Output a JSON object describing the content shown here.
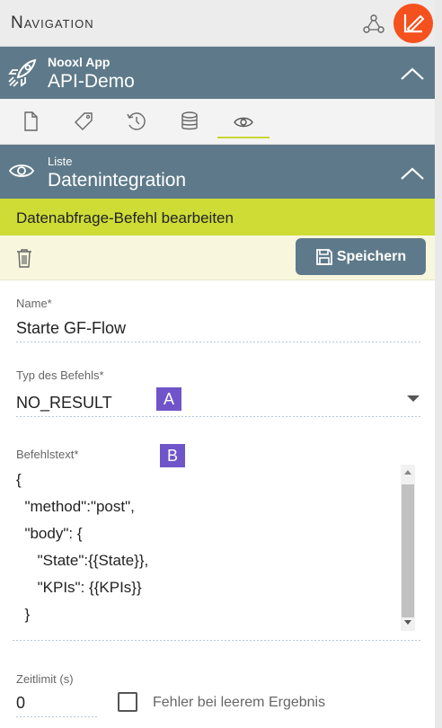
{
  "header": {
    "title": "Navigation"
  },
  "app": {
    "subtitle": "Nooxl App",
    "title": "API-Demo"
  },
  "section": {
    "subtitle": "Liste",
    "title": "Datenintegration"
  },
  "edit_bar": {
    "title": "Datenabfrage-Befehl bearbeiten"
  },
  "toolbar": {
    "save_label": "Speichern"
  },
  "form": {
    "name": {
      "label": "Name*",
      "value": "Starte GF-Flow"
    },
    "type": {
      "label": "Typ des Befehls*",
      "value": "NO_RESULT"
    },
    "command": {
      "label": "Befehlstext*",
      "lines": [
        "{",
        "  \"method\":\"post\",",
        "  \"body\": {",
        "     \"State\":{{State}},",
        "     \"KPIs\": {{KPIs}}",
        "  }"
      ]
    },
    "timeout": {
      "label": "Zeitlimit (s)",
      "value": "0"
    },
    "empty_error": {
      "label": "Fehler bei leerem Ergebnis",
      "checked": false
    }
  },
  "annotations": {
    "a": "A",
    "b": "B"
  },
  "icons": [
    "share-network-icon",
    "edit-chart-icon",
    "rocket-icon",
    "chevron-up-icon",
    "document-icon",
    "tag-icon",
    "history-icon",
    "database-icon",
    "eye-icon",
    "trash-icon",
    "floppy-disk-icon"
  ],
  "colors": {
    "bar": "#5e7a8a",
    "accent": "#cedc35",
    "orange": "#f4511e",
    "badge": "#6f55c9"
  }
}
